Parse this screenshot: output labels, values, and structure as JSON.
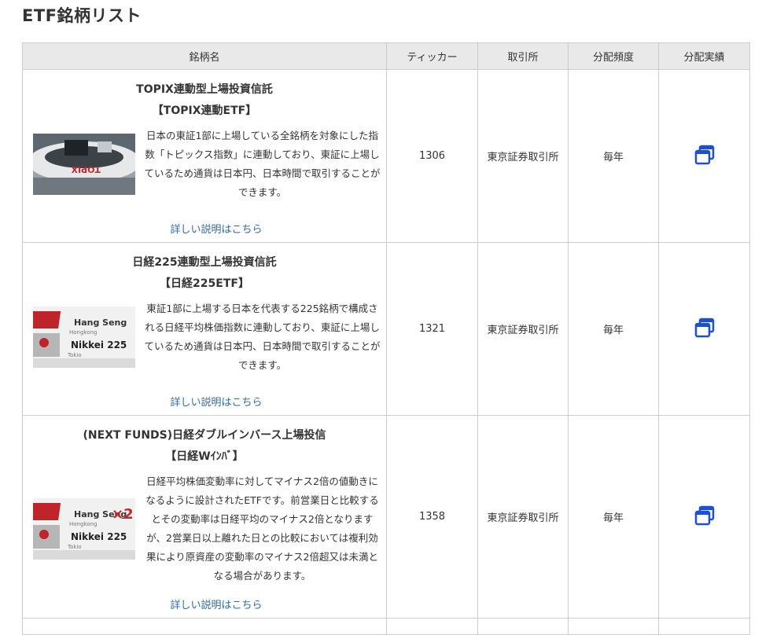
{
  "page": {
    "title": "ETF銘柄リスト"
  },
  "table": {
    "headers": [
      "銘柄名",
      "ティッカー",
      "取引所",
      "分配頻度",
      "分配実績"
    ],
    "link_label": "詳しい説明はこちら",
    "rows": [
      {
        "name_line1": "TOPIX連動型上場投資信託",
        "name_line2": "【TOPIX連動ETF】",
        "thumbnail": "topix-thumbnail",
        "description": "日本の東証1部に上場している全銘柄を対象にした指数「トピックス指数」に連動しており、東証に上場しているため通貨は日本円、日本時間で取引することができます。",
        "ticker": "1306",
        "exchange": "東京証券取引所",
        "frequency": "毎年",
        "icon": "window-stack-icon"
      },
      {
        "name_line1": "日経225連動型上場投資信託",
        "name_line2": "【日経225ETF】",
        "thumbnail": "nikkei225-thumbnail",
        "description": "東証1部に上場する日本を代表する225銘柄で構成される日経平均株価指数に連動しており、東証に上場しているため通貨は日本円、日本時間で取引することができます。",
        "ticker": "1321",
        "exchange": "東京証券取引所",
        "frequency": "毎年",
        "icon": "window-stack-icon"
      },
      {
        "name_line1": "(NEXT FUNDS)日経ダブルインバース上場投信",
        "name_line2": "【日経Wｲﾝﾊﾞ】",
        "thumbnail": "nikkei-double-inverse-thumbnail",
        "description": "日経平均株価変動率に対してマイナス2倍の値動きになるように設計されたETFです。前営業日と比較するとその変動率は日経平均のマイナス2倍となりますが、2営業日以上離れた日との比較においては複利効果により原資産の変動率のマイナス2倍超又は未満となる場合があります。",
        "ticker": "1358",
        "exchange": "東京証券取引所",
        "frequency": "毎年",
        "icon": "window-stack-icon"
      }
    ]
  },
  "thumbnail_text": {
    "topix": "TOPIX",
    "hang_seng": "Hang Seng",
    "hongkong": "Hongkong",
    "nikkei": "Nikkei 225",
    "tokio": "Tokio",
    "times_two": "×2"
  },
  "colors": {
    "link": "#2b6cb0",
    "icon": "#1a4fd6",
    "header_bg": "#e9e9e9",
    "border": "#cccccc"
  }
}
